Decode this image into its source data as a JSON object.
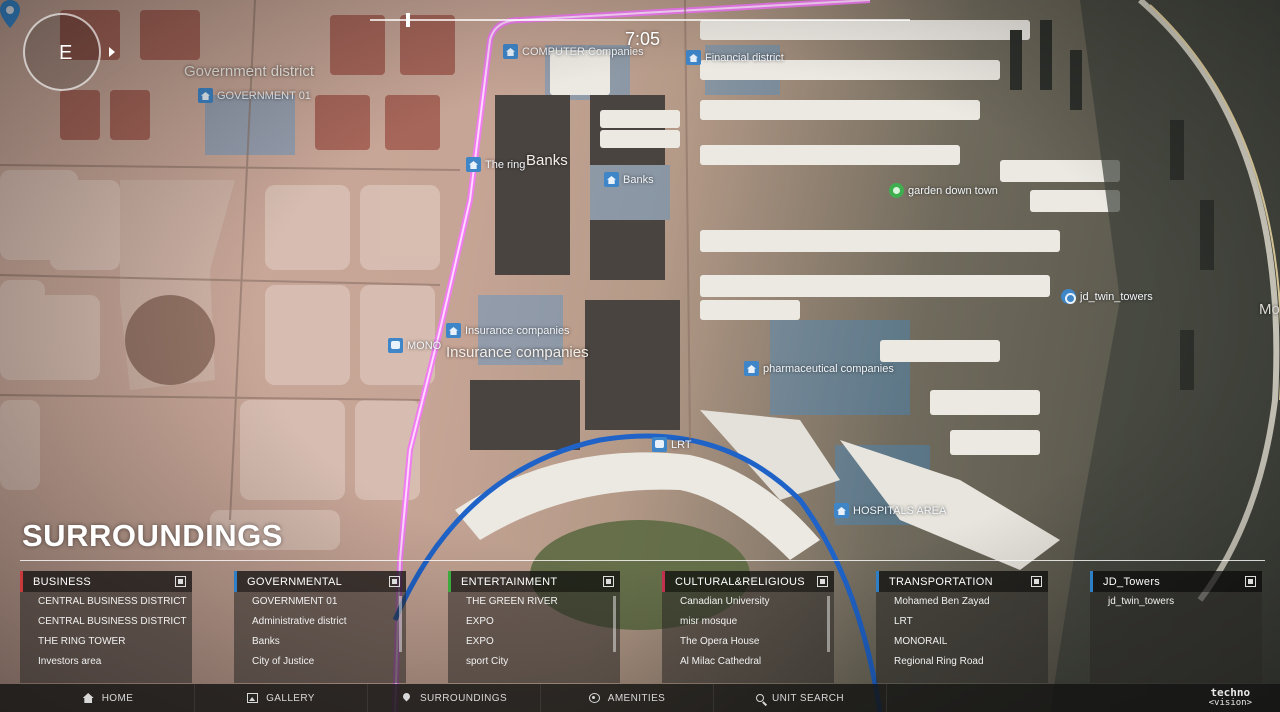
{
  "compass": {
    "direction": "E"
  },
  "timeline": {
    "time": "7:05"
  },
  "map_labels": [
    {
      "key": "gov_district",
      "text": "Government district",
      "style": "big"
    },
    {
      "key": "gov_01",
      "text": "GOVERNMENT 01",
      "icon": "building-pin-icon"
    },
    {
      "key": "computer",
      "text": "COMPUTER Companies",
      "icon": "building-pin-icon"
    },
    {
      "key": "financial",
      "text": "Financial district",
      "icon": "building-pin-icon"
    },
    {
      "key": "banks_big",
      "text": "Banks",
      "style": "big"
    },
    {
      "key": "the_ring",
      "text": "The ring",
      "icon": "building-pin-icon"
    },
    {
      "key": "banks",
      "text": "Banks",
      "icon": "building-pin-icon"
    },
    {
      "key": "garden",
      "text": "garden down town",
      "icon": "garden-pin-icon"
    },
    {
      "key": "jd_towers",
      "text": "jd_twin_towers",
      "icon": "tower-pin-icon"
    },
    {
      "key": "mo",
      "text": "Mo",
      "style": "big"
    },
    {
      "key": "insurance",
      "text": "Insurance companies",
      "icon": "building-pin-icon"
    },
    {
      "key": "monorail",
      "text": "MONO",
      "icon": "transit-pin-icon"
    },
    {
      "key": "insurance_big",
      "text": "Insurance companies",
      "style": "big"
    },
    {
      "key": "pharma",
      "text": "pharmaceutical companies",
      "icon": "building-pin-icon"
    },
    {
      "key": "lrt",
      "text": "LRT",
      "icon": "transit-pin-icon"
    },
    {
      "key": "hospitals",
      "text": "HOSPITALS AREA",
      "icon": "building-pin-icon"
    }
  ],
  "surroundings": {
    "title": "SURROUNDINGS",
    "categories": [
      {
        "name": "BUSINESS",
        "color": "#c7393a",
        "items": [
          "CENTRAL BUSINESS DISTRICT",
          "CENTRAL BUSINESS DISTRICT",
          "THE RING TOWER",
          "Investors area"
        ]
      },
      {
        "name": "GOVERNMENTAL",
        "color": "#2f7fc6",
        "items": [
          "GOVERNMENT 01",
          "Administrative district",
          "Banks",
          "City of Justice"
        ]
      },
      {
        "name": "ENTERTAINMENT",
        "color": "#3caa3c",
        "items": [
          "THE GREEN RIVER",
          "EXPO",
          "EXPO",
          "sport City"
        ]
      },
      {
        "name": "CULTURAL&RELIGIOUS",
        "color": "#c2304e",
        "items": [
          "Canadian University",
          "misr mosque",
          "The Opera House",
          "Al Milac Cathedral"
        ]
      },
      {
        "name": "TRANSPORTATION",
        "color": "#2f7fc6",
        "items": [
          "Mohamed Ben Zayad",
          "LRT",
          "MONORAIL",
          "Regional Ring Road"
        ]
      },
      {
        "name": "JD_Towers",
        "color": "#2f7fc6",
        "items": [
          "jd_twin_towers"
        ]
      }
    ]
  },
  "nav": {
    "items": [
      {
        "label": "HOME",
        "icon": "home-icon"
      },
      {
        "label": "GALLERY",
        "icon": "gallery-icon"
      },
      {
        "label": "SURROUNDINGS",
        "icon": "pin-icon"
      },
      {
        "label": "AMENITIES",
        "icon": "amenities-icon"
      },
      {
        "label": "UNIT SEARCH",
        "icon": "search-icon"
      }
    ]
  },
  "brand": {
    "line1": "techno",
    "line2": "<vision>"
  },
  "colors": {
    "ring_road": "#f07cf0",
    "lrt_line": "#1f63c8",
    "district_highlight": "#3a8fd8"
  }
}
